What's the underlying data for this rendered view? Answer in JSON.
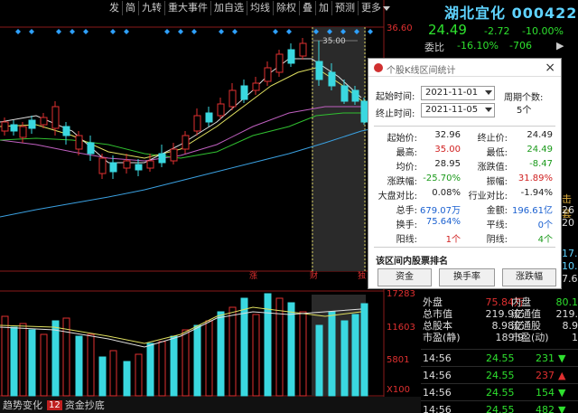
{
  "toolbar": {
    "items": [
      "发",
      "简",
      "九转",
      "重大事件",
      "加自选",
      "均线",
      "除权",
      "叠",
      "加",
      "预测",
      "更多"
    ]
  },
  "chart": {
    "price_axis": [
      "36.60"
    ],
    "vol_axis": [
      "17283",
      "11603",
      "5801",
      "X100"
    ],
    "peak_label": "35.00",
    "date_marks": [
      "涨",
      "财",
      "独"
    ]
  },
  "chart_data": {
    "type": "candlestick",
    "period_start": "2021-11-01",
    "period_end": "2021-11-05",
    "interval_high": 35.0,
    "interval_low": 24.49
  },
  "stock": {
    "name": "湖北宜化",
    "code": "000422",
    "price": "24.49",
    "change": "-2.72",
    "change_pct": "-10.00%",
    "ratio_label": "委比",
    "ratio_pct": "-16.10%",
    "ratio_val": "-706",
    "ratio_arrow": "▶"
  },
  "right_stats": [
    {
      "l": "外盘",
      "v": "75.84万",
      "l2": "内盘",
      "v2": "80.1"
    },
    {
      "l": "总市值",
      "v": "219.9亿",
      "l2": "流通值",
      "v2": "219."
    },
    {
      "l": "总股本",
      "v": "8.98亿",
      "l2": "流通股",
      "v2": "8.9"
    },
    {
      "l": "市盈(静)",
      "v": "189.9",
      "l2": "市盈(动)",
      "v2": "1"
    }
  ],
  "right_clipped": {
    "lines": [
      "击套",
      "26",
      "20",
      "17.",
      "10.",
      "7.6"
    ]
  },
  "ticks": [
    {
      "time": "14:56",
      "price": "24.55",
      "vol": "231",
      "dir": "▼",
      "color": "#2ee02e"
    },
    {
      "time": "14:56",
      "price": "24.55",
      "vol": "237",
      "dir": "▲",
      "color": "#e03030"
    },
    {
      "time": "14:56",
      "price": "24.55",
      "vol": "154",
      "dir": "▼",
      "color": "#2ee02e"
    },
    {
      "time": "14:56",
      "price": "24.55",
      "vol": "482",
      "dir": "▼",
      "color": "#2ee02e"
    }
  ],
  "bottom_bar": {
    "item1": "趋势变化",
    "num": "12",
    "item2": "资金抄底"
  },
  "popup": {
    "title": "个股K线区间统计",
    "start_label": "起始时间:",
    "start_date": "2021-11-01",
    "end_label": "终止时间:",
    "end_date": "2021-11-05",
    "cycle_label": "周期个数:",
    "cycle_val": "5个",
    "rows": [
      {
        "l1": "起始价:",
        "v1": "32.96",
        "c1": "",
        "l2": "终止价:",
        "v2": "24.49",
        "c2": ""
      },
      {
        "l1": "最高:",
        "v1": "35.00",
        "c1": "red",
        "l2": "最低:",
        "v2": "24.49",
        "c2": "green"
      },
      {
        "l1": "均价:",
        "v1": "28.95",
        "c1": "",
        "l2": "涨跌值:",
        "v2": "-8.47",
        "c2": "green"
      },
      {
        "l1": "涨跌幅:",
        "v1": "-25.70%",
        "c1": "green",
        "l2": "振幅:",
        "v2": "31.89%",
        "c2": "red"
      },
      {
        "l1": "大盘对比:",
        "v1": "0.08%",
        "c1": "",
        "l2": "行业对比:",
        "v2": "-1.94%",
        "c2": ""
      },
      {
        "l1": "总手:",
        "v1": "679.07万",
        "c1": "blue",
        "l2": "金额:",
        "v2": "196.61亿",
        "c2": "blue"
      },
      {
        "l1": "换手:",
        "v1": "75.64%",
        "c1": "blue",
        "l2": "平线:",
        "v2": "0个",
        "c2": "blue"
      },
      {
        "l1": "阳线:",
        "v1": "1个",
        "c1": "red",
        "l2": "阴线:",
        "v2": "4个",
        "c2": "green"
      }
    ],
    "rank_title": "该区间内股票排名",
    "btn_amount": "资金",
    "btn_turnover": "换手率",
    "btn_change": "涨跌幅"
  }
}
